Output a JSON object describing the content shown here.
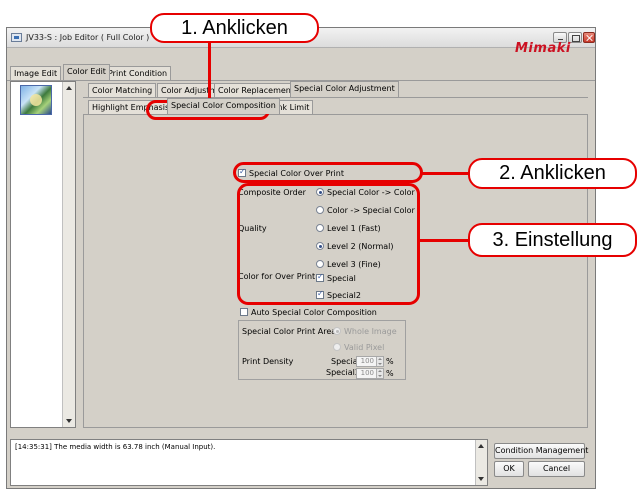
{
  "window": {
    "title": "JV33-S : Job Editor ( Full Color )",
    "logo": "Mimaki"
  },
  "main_tabs": [
    "Image Edit",
    "Color Edit",
    "Print Condition"
  ],
  "sub_tabs": [
    "Color Matching",
    "Color Adjustment",
    "Color Replacement",
    "Special Color Adjustment"
  ],
  "inner_tabs": [
    "Highlight Emphasis",
    "Special Color Composition",
    "Ink Limit"
  ],
  "special_color_over_print": {
    "label": "Special Color Over Print",
    "checked": true
  },
  "composite_order": {
    "label": "Composite Order",
    "options": [
      "Special Color -> Color",
      "Color -> Special Color"
    ],
    "selected": "Special Color -> Color"
  },
  "quality": {
    "label": "Quality",
    "options": [
      "Level 1 (Fast)",
      "Level 2 (Normal)",
      "Level 3 (Fine)"
    ],
    "selected": "Level 2 (Normal)"
  },
  "color_for_over_print": {
    "label": "Color for Over Print",
    "items": [
      {
        "label": "Special",
        "checked": true
      },
      {
        "label": "Special2",
        "checked": true
      }
    ]
  },
  "auto_special_color_composition": {
    "label": "Auto Special Color Composition",
    "checked": false
  },
  "special_color_print_area": {
    "label": "Special Color Print Area",
    "options": [
      "Whole Image",
      "Valid Pixel"
    ],
    "selected": "Whole Image"
  },
  "print_density": {
    "label": "Print Density",
    "rows": [
      {
        "label": "Special",
        "value": "100",
        "unit": "%"
      },
      {
        "label": "Special2",
        "value": "100",
        "unit": "%"
      }
    ]
  },
  "log": {
    "message": "[14:35:31] The media width is 63.78 inch (Manual Input)."
  },
  "buttons": {
    "condition_management": "Condition Management",
    "ok": "OK",
    "cancel": "Cancel"
  },
  "callouts": [
    "1. Anklicken",
    "2. Anklicken",
    "3. Einstellung"
  ],
  "colors": {
    "callout": "#e60000",
    "logo": "#cc1122",
    "window_bg": "#d4d0c8"
  }
}
